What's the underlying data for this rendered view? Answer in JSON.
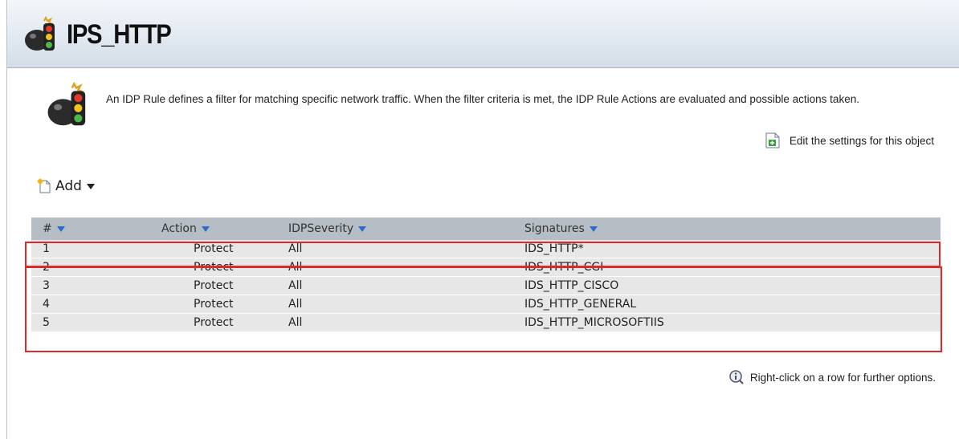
{
  "header": {
    "title": "IPS_HTTP",
    "icon": "traffic-light-bomb-icon"
  },
  "info": {
    "icon": "traffic-light-bomb-icon",
    "description": "An IDP Rule defines a filter for matching specific network traffic. When the filter criteria is met, the IDP Rule Actions are evaluated and possible actions taken."
  },
  "edit_link": {
    "label": "Edit the settings for this object",
    "icon": "edit-document-icon"
  },
  "toolbar": {
    "add_label": "Add",
    "add_icon": "new-document-icon"
  },
  "grid": {
    "columns": [
      "#",
      "Action",
      "IDPSeverity",
      "Signatures"
    ],
    "rows": [
      {
        "num": "1",
        "action": "Protect",
        "severity": "All",
        "signatures": "IDS_HTTP*"
      },
      {
        "num": "2",
        "action": "Protect",
        "severity": "All",
        "signatures": "IDS_HTTP_CGI"
      },
      {
        "num": "3",
        "action": "Protect",
        "severity": "All",
        "signatures": "IDS_HTTP_CISCO"
      },
      {
        "num": "4",
        "action": "Protect",
        "severity": "All",
        "signatures": "IDS_HTTP_GENERAL"
      },
      {
        "num": "5",
        "action": "Protect",
        "severity": "All",
        "signatures": "IDS_HTTP_MICROSOFTIIS"
      }
    ]
  },
  "footer": {
    "hint": "Right-click on a row for further options.",
    "icon": "info-magnifier-icon"
  },
  "colors": {
    "highlight": "#e0282b",
    "header_row": "#b7bdc4",
    "row": "#e7e7e7",
    "sort_caret": "#2a6cc8"
  }
}
